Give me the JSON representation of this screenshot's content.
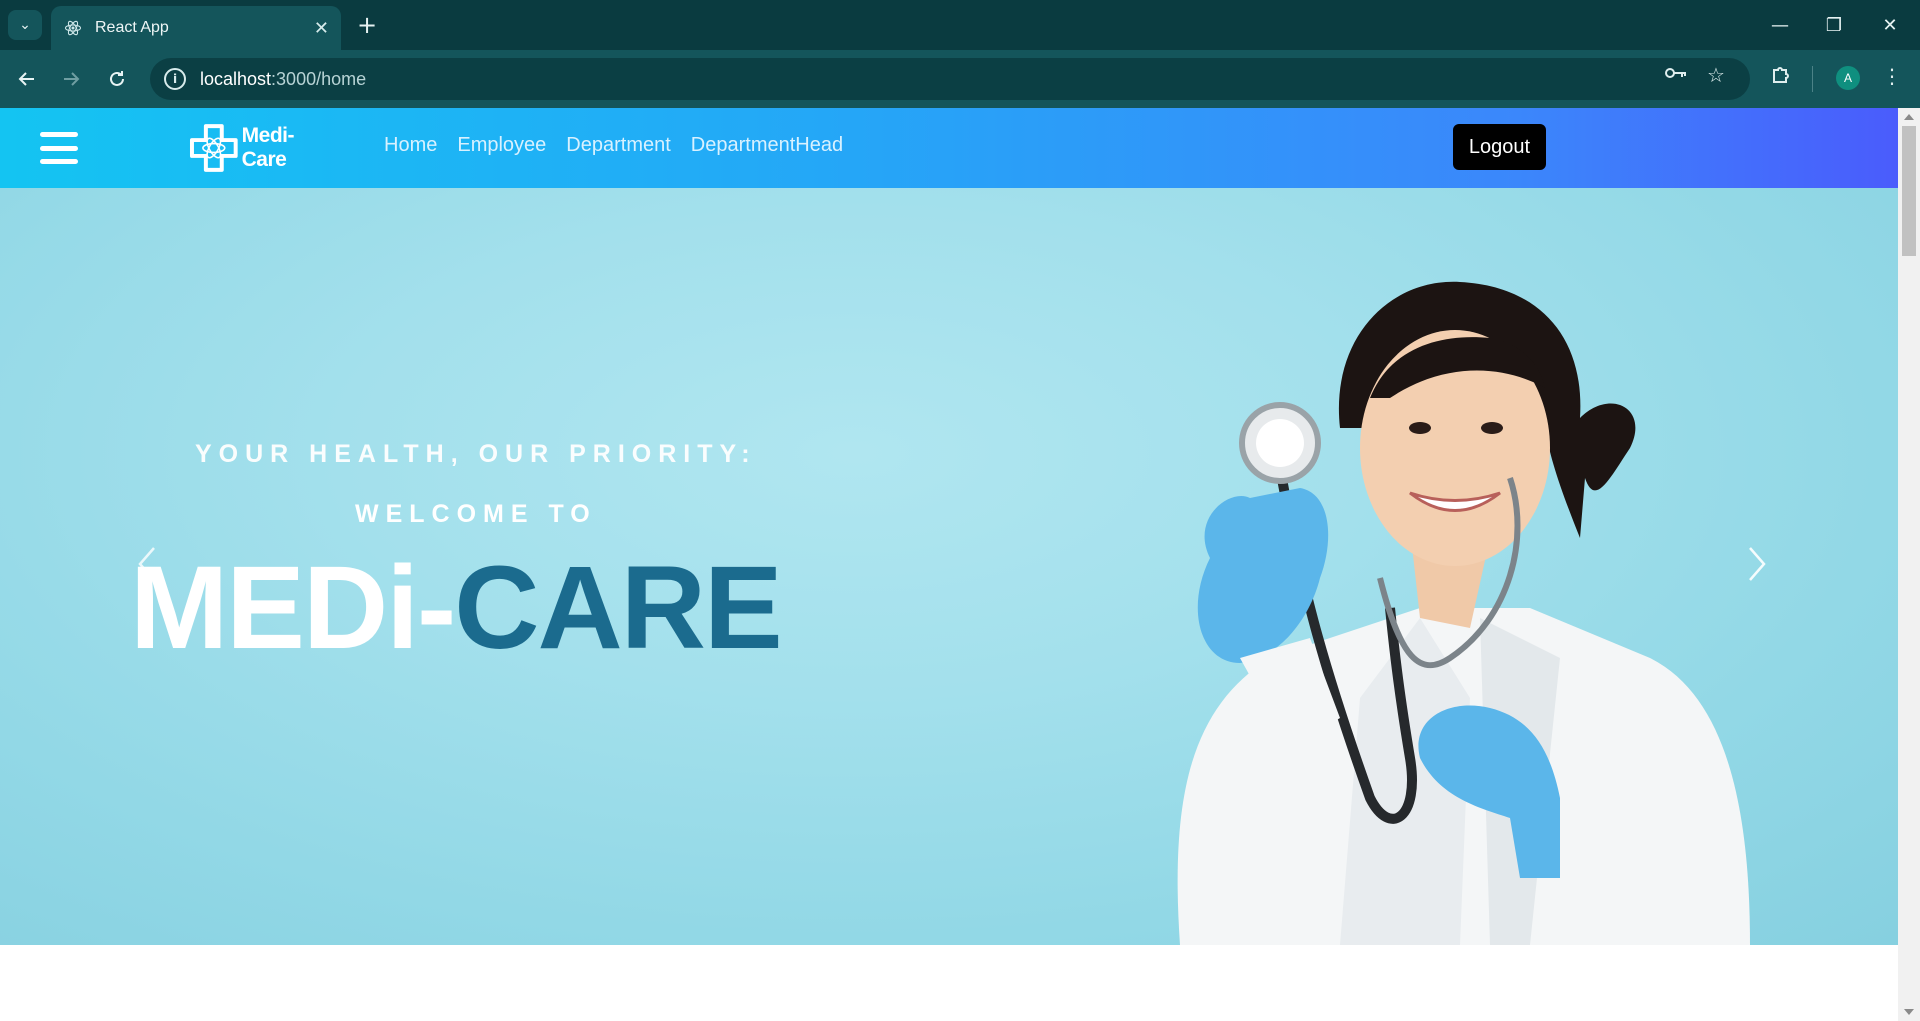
{
  "browser": {
    "tab_title": "React App",
    "url_host": "localhost",
    "url_path": ":3000/home",
    "profile_initial": "A"
  },
  "navbar": {
    "brand": "Medi-Care",
    "links": [
      "Home",
      "Employee",
      "Department",
      "DepartmentHead"
    ],
    "logout_label": "Logout"
  },
  "hero": {
    "tagline": "YOUR HEALTH, OUR PRIORITY:",
    "welcome": "WELCOME TO",
    "title_part1": "MEDi-",
    "title_part2": "CARE"
  },
  "colors": {
    "navbar_gradient_start": "#14c4f2",
    "navbar_gradient_end": "#4a5cfc",
    "hero_bg": "#a3e0ec",
    "title_accent": "#1b6b8e",
    "logout_bg": "#000000"
  }
}
